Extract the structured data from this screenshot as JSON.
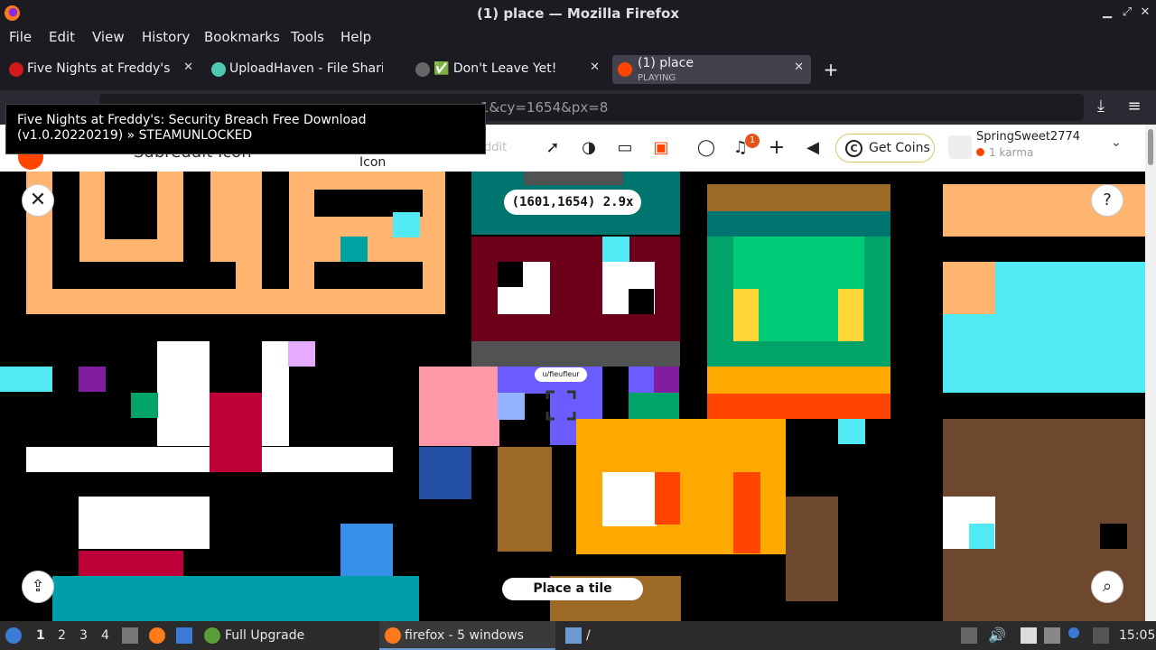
{
  "window": {
    "title": "(1) place — Mozilla Firefox"
  },
  "menu": [
    "File",
    "Edit",
    "View",
    "History",
    "Bookmarks",
    "Tools",
    "Help"
  ],
  "tabs": [
    {
      "label": "Five Nights at Freddy's:",
      "icon_color": "#d11b1b",
      "active": false
    },
    {
      "label": "UploadHaven - File Sharin",
      "icon_color": "#4ec9b0",
      "active": false
    },
    {
      "label": "✅ Don't Leave Yet!",
      "icon_color": "#666666",
      "active": false
    },
    {
      "label": "(1) place",
      "sublabel": "PLAYING",
      "icon_color": "#ff4500",
      "active": true
    }
  ],
  "url": {
    "visible_text": "1&cy=1654&px=8"
  },
  "tooltip": {
    "text": "Five Nights at Freddy's: Security Breach Free Download (v1.0.20220219) » STEAMUNLOCKED"
  },
  "reddit": {
    "subreddit_text": "Subreddit Icon",
    "icon_label": "Icon",
    "search_placeholder": "ddit",
    "notification_count": "1",
    "get_coins_label": "Get Coins",
    "username": "SpringSweet2774",
    "karma": "1 karma"
  },
  "place": {
    "coordinates": "(1601,1654) 2.9x",
    "hover_user": "u/fieufleur",
    "place_button": "Place a tile"
  },
  "taskbar": {
    "workspaces": [
      "1",
      "2",
      "3",
      "4"
    ],
    "upgrade_label": "Full Upgrade",
    "firefox_label": "firefox - 5 windows",
    "folder_label": "/",
    "clock": "15:05"
  },
  "colors": {
    "accent_reddit": "#ff4500",
    "chrome_dark": "#1c1b22",
    "tab_active": "#42414d"
  }
}
